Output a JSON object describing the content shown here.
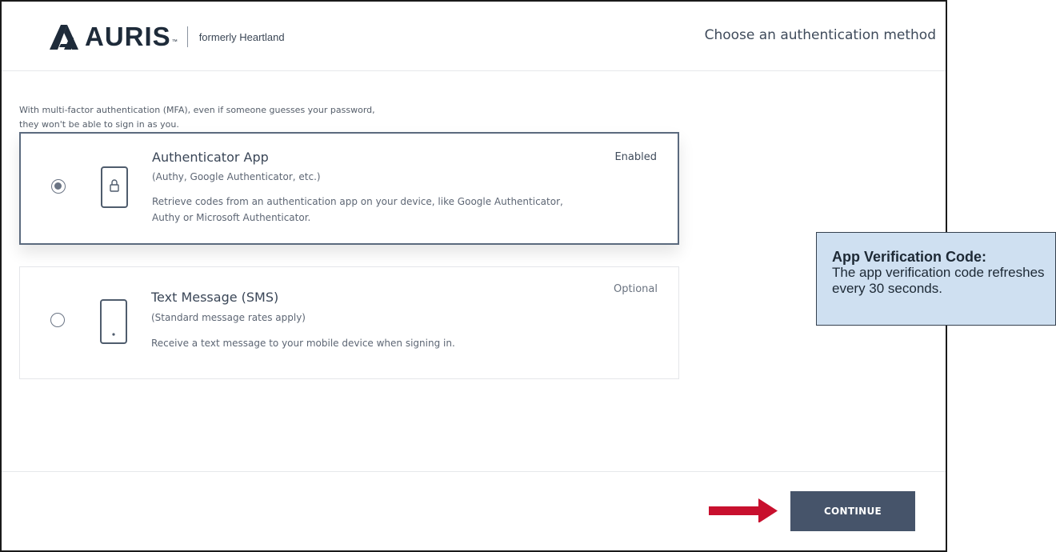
{
  "header": {
    "brand": "AURIS",
    "brand_tm": "™",
    "brand_sub": "formerly Heartland",
    "title": "Choose an authentication method"
  },
  "intro_lines": [
    "With multi-factor authentication (MFA), even if someone guesses your password,",
    "they won't be able to sign in as you."
  ],
  "methods": [
    {
      "title": "Authenticator App",
      "subtitle": "(Authy, Google Authenticator, etc.)",
      "description": "Retrieve codes from an authentication app on your device, like Google Authenticator, Authy or Microsoft Authenticator.",
      "status": "Enabled",
      "selected": true,
      "icon": "phone-lock-icon"
    },
    {
      "title": "Text Message (SMS)",
      "subtitle": "(Standard message rates apply)",
      "description": "Receive a text message to your mobile device when signing in.",
      "status": "Optional",
      "selected": false,
      "icon": "mobile-phone-icon"
    }
  ],
  "footer": {
    "continue_label": "CONTINUE"
  },
  "callout": {
    "title": "App Verification Code:",
    "body": "The app verification code refreshes every 30 seconds."
  },
  "colors": {
    "button": "#46546a",
    "arrow": "#c8102e",
    "callout_bg": "#cfe0f1",
    "selected_border": "#5b6a7e"
  }
}
